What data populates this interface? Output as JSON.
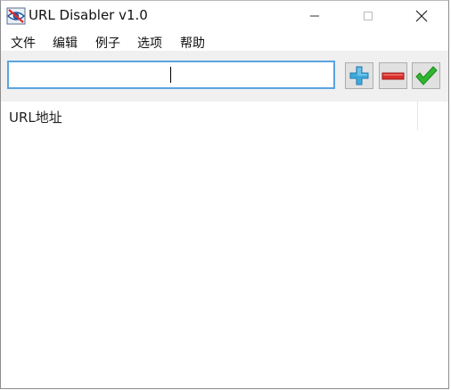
{
  "window": {
    "title": "URL Disabler v1.0"
  },
  "menu": [
    {
      "label": "文件"
    },
    {
      "label": "编辑"
    },
    {
      "label": "例子"
    },
    {
      "label": "选项"
    },
    {
      "label": "帮助"
    }
  ],
  "toolbar": {
    "url_input_value": "",
    "add_icon": "plus-icon",
    "remove_icon": "minus-icon",
    "apply_icon": "checkmark-icon"
  },
  "list": {
    "column_header": "URL地址",
    "rows": []
  },
  "colors": {
    "input_border": "#5aa3e0",
    "add_icon": "#3fa9dc",
    "remove_icon": "#d9302c",
    "apply_icon": "#2fb52f",
    "toolbar_bg": "#f0f0f0"
  }
}
